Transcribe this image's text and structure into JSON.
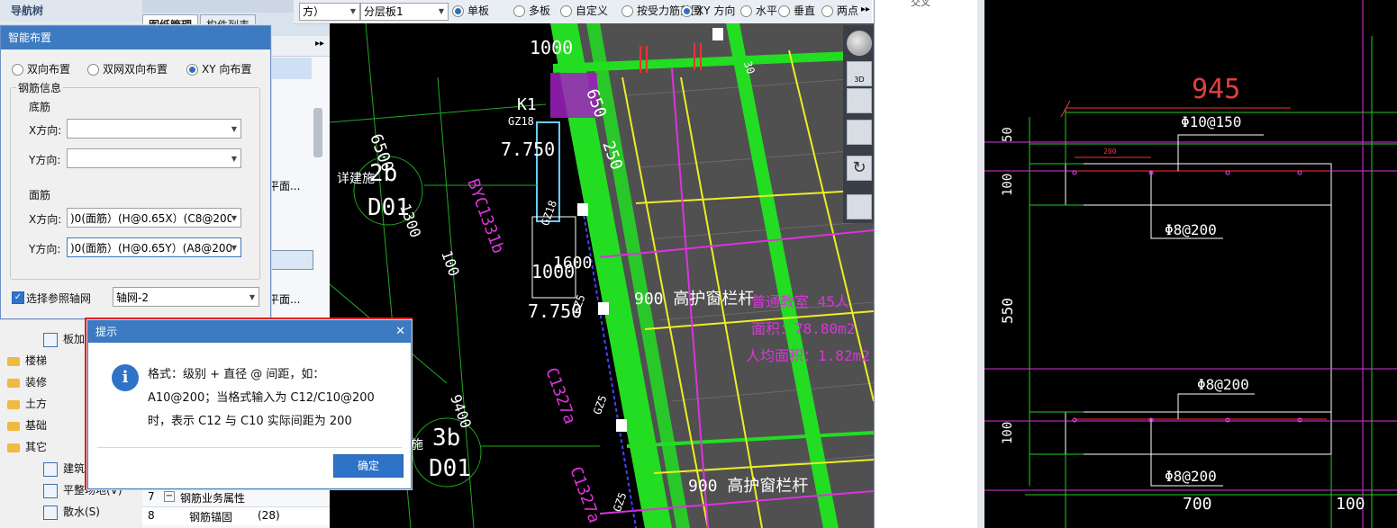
{
  "nav_tree": {
    "title": "导航树",
    "items": [
      {
        "label": "板加",
        "icon": "filter-icon",
        "type": "sub"
      },
      {
        "label": "楼梯",
        "icon": "folder-icon",
        "type": "folder"
      },
      {
        "label": "装修",
        "icon": "folder-icon",
        "type": "folder"
      },
      {
        "label": "土方",
        "icon": "folder-icon",
        "type": "folder"
      },
      {
        "label": "基础",
        "icon": "folder-icon",
        "type": "folder"
      },
      {
        "label": "其它",
        "icon": "folder-open-icon",
        "type": "folder"
      },
      {
        "label": "建筑",
        "icon": "square-icon",
        "type": "sub"
      },
      {
        "label": "平整场地(V)",
        "icon": "brush-icon",
        "type": "sub"
      },
      {
        "label": "散水(S)",
        "icon": "square-icon",
        "type": "sub"
      }
    ]
  },
  "middle_panel": {
    "tabs": [
      "图纸管理",
      "构件列表"
    ],
    "rows": [
      "平面...",
      "平面..."
    ],
    "prop_rows": [
      {
        "num": "7",
        "name": "钢筋业务属性",
        "value": ""
      },
      {
        "num": "8",
        "name": "钢筋锚固",
        "value": "(28)"
      }
    ]
  },
  "smart_dialog": {
    "title": "智能布置",
    "layout_options": [
      "双向布置",
      "双网双向布置",
      "XY 向布置"
    ],
    "layout_selected": 2,
    "rebar_group_title": "钢筋信息",
    "bottom_rebar_label": "底筋",
    "top_rebar_label": "面筋",
    "x_dir_label": "X方向:",
    "y_dir_label": "Y方向:",
    "bottom_x_value": "",
    "bottom_y_value": "",
    "top_x_value": ")0(面筋）(H@0.65X）(C8@200)",
    "top_y_value": ")0(面筋）(H@0.65Y）(A8@200)",
    "ref_grid_checkbox_label": "选择参照轴网",
    "ref_grid_checked": true,
    "ref_grid_value": "轴网-2"
  },
  "tip_dialog": {
    "title": "提示",
    "line1": "格式：级别 + 直径 @ 间距，如：",
    "line2": "A10@200；当格式输入为 C12/C10@200",
    "line3": "时，表示 C12 与 C10 实际间距为 200",
    "ok_label": "确定"
  },
  "toolbar": {
    "dir_combo": "方）",
    "layer_combo": "分层板1",
    "options": [
      {
        "label": "单板",
        "checked": true
      },
      {
        "label": "多板",
        "checked": false
      },
      {
        "label": "自定义",
        "checked": false
      },
      {
        "label": "按受力筋范围",
        "checked": false
      },
      {
        "label": "XY 方向",
        "checked": true
      },
      {
        "label": "水平",
        "checked": false
      },
      {
        "label": "垂直",
        "checked": false
      },
      {
        "label": "两点",
        "checked": false
      }
    ]
  },
  "cad_view": {
    "labels": {
      "k1": "K1",
      "gz18a": "GZ18",
      "gz18b": "GZ18",
      "gz5a": "GZ5",
      "gz5b": "GZ5",
      "gz5c": "GZ5",
      "lvl1": "7.750",
      "lvl2": "7.750",
      "b1": "1000",
      "b2": "1000",
      "dim250": "250",
      "dim650": "650",
      "dim6500": "6500",
      "dim1300": "1300",
      "dim9400": "9400",
      "dim100": "100",
      "dim1600": "1600",
      "c1": "BYC1331b",
      "c2": "C1327a",
      "c3": "C1327a",
      "axis1_top": "2b",
      "axis1_bot": "D01",
      "axis2_top": "3b",
      "axis2_bot": "D01",
      "note1": "详建施",
      "note2": "施",
      "rail1": "900 高护窗栏杆",
      "rail2": "900 高护窗栏杆",
      "room1": "普通教室 45人",
      "room2": "面积：78.80m2",
      "room3": "人均面积：1.82m2",
      "dim30": "30"
    }
  },
  "section_view": {
    "labels": {
      "dim945": "945",
      "bar1": "Φ10@150",
      "bar2": "Φ8@200",
      "bar3": "Φ8@200",
      "bar4": "Φ8@200",
      "dim200": "200",
      "h50": "50",
      "h100a": "100",
      "h550": "550",
      "h100b": "100",
      "w700": "700",
      "w100": "100",
      "row_label": "交叉"
    }
  },
  "colors": {
    "cad_bg": "#000000",
    "green": "#22dd22",
    "magenta": "#dd33dd",
    "yellow": "#eeee22",
    "red_dim": "#e04040",
    "dialog_title": "#3c7ac2",
    "info_icon": "#2f73c9"
  }
}
